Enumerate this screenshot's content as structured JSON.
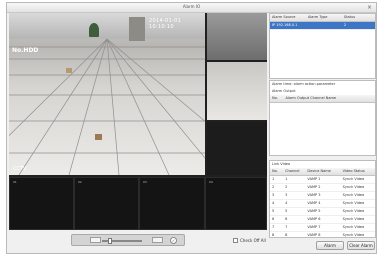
{
  "window": {
    "title": "Alarm IO"
  },
  "video": {
    "main_label": "No.HDD",
    "main_time": "2014-01-01 10:10:10",
    "main_watermark": "CCTV",
    "side_channels": [
      "",
      "",
      ""
    ],
    "bottom_channels": [
      "01",
      "02",
      "03",
      "04"
    ]
  },
  "alarm_table": {
    "columns": [
      "Alarm Source",
      "Alarm Type",
      "Status"
    ],
    "rows": [
      [
        "IP 192.168.0.1",
        "",
        "2"
      ]
    ]
  },
  "alarm_output": {
    "notice": "Alarm time: alarm action parameter",
    "section_label": "Alarm Output",
    "columns": [
      "No.",
      "Alarm Output Channel Name"
    ]
  },
  "link_video": {
    "section_label": "Link Video",
    "columns": [
      "No.",
      "Channel",
      "Device Name",
      "Video Status"
    ],
    "rows": [
      [
        "1",
        "1",
        "VAMP 1",
        "Synch Video"
      ],
      [
        "2",
        "2",
        "VAMP 2",
        "Synch Video"
      ],
      [
        "3",
        "3",
        "VAMP 3",
        "Synch Video"
      ],
      [
        "4",
        "4",
        "VAMP 4",
        "Synch Video"
      ],
      [
        "5",
        "5",
        "VAMP 5",
        "Synch Video"
      ],
      [
        "6",
        "6",
        "VAMP 6",
        "Synch Video"
      ],
      [
        "7",
        "7",
        "VAMP 7",
        "Synch Video"
      ],
      [
        "8",
        "8",
        "VAMP 8",
        "Synch Video"
      ]
    ]
  },
  "controls": {
    "checkbox_label": "Check Off All",
    "alarm_button": "Alarm",
    "clear_button": "Clear Alarm"
  }
}
